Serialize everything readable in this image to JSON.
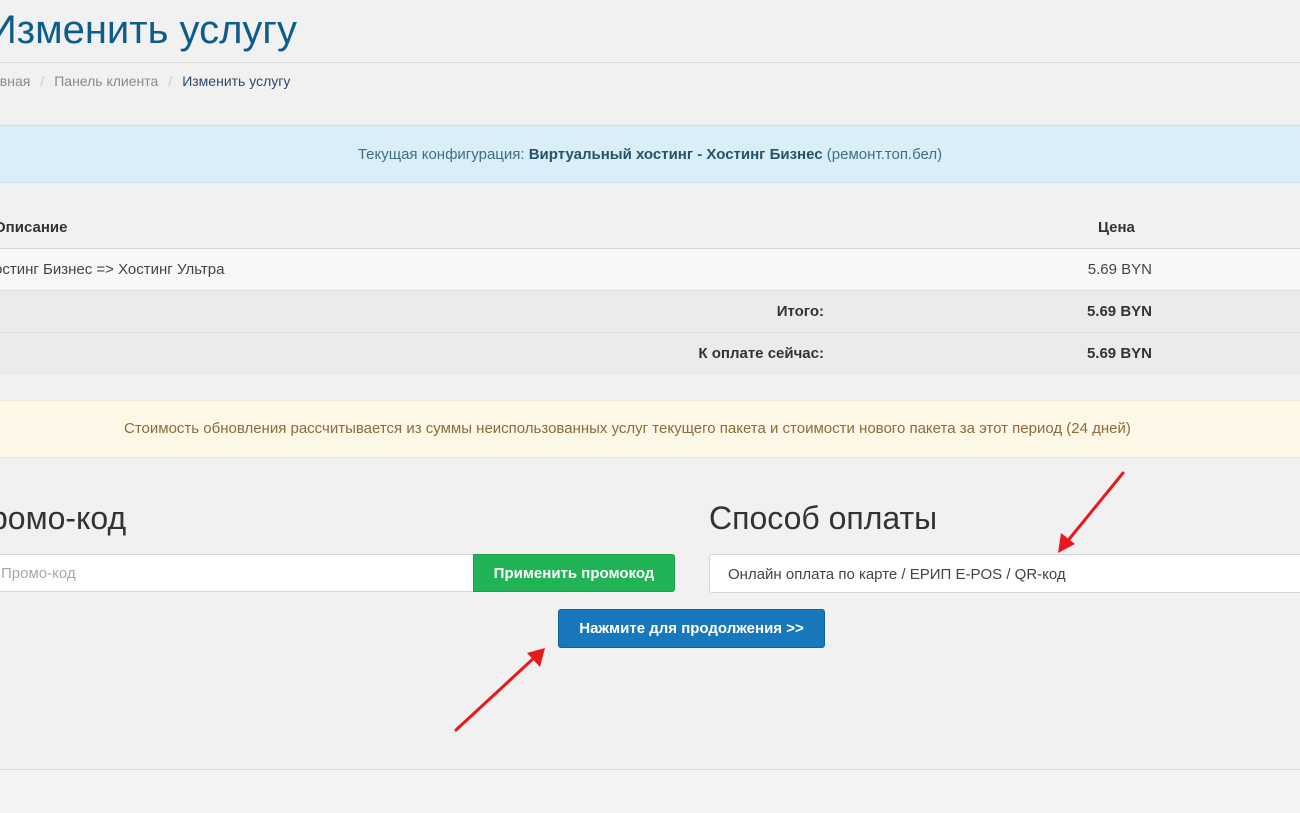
{
  "page": {
    "title": "Изменить услугу"
  },
  "breadcrumb": {
    "items": [
      {
        "label": "авная"
      },
      {
        "label": "Панель клиента"
      },
      {
        "label": "Изменить услугу"
      }
    ],
    "separator": "/"
  },
  "current_config": {
    "prefix": "Текущая конфигурация: ",
    "product": "Виртуальный хостинг - Хостинг Бизнес",
    "domain": " (ремонт.топ.бел)"
  },
  "summary": {
    "headers": {
      "description": "Описание",
      "price": "Цена"
    },
    "item": {
      "description": "остинг Бизнес => Хостинг Ультра",
      "price": "5.69 BYN"
    },
    "total": {
      "label": "Итого:",
      "value": "5.69 BYN"
    },
    "due_now": {
      "label": "К оплате сейчас:",
      "value": "5.69 BYN"
    }
  },
  "notice": {
    "text": "Стоимость обновления рассчитывается из суммы неиспользованных услуг текущего пакета и стоимости нового пакета за этот период (24 дней)"
  },
  "promo": {
    "heading": "ромо-код",
    "placeholder": "Промо-код",
    "apply_label": "Применить промокод"
  },
  "payment": {
    "heading": "Способ оплаты",
    "selected": "Онлайн оплата по карте / ЕРИП E-POS / QR-код"
  },
  "continue": {
    "label": "Нажмите для продолжения >>"
  },
  "colors": {
    "title": "#0d5c8a",
    "info_bar": "#d9eef7",
    "notice_bar": "#fcf7e6",
    "apply_button": "#21b457",
    "continue_button": "#1779bb",
    "annotation_arrow": "#e8191c"
  }
}
